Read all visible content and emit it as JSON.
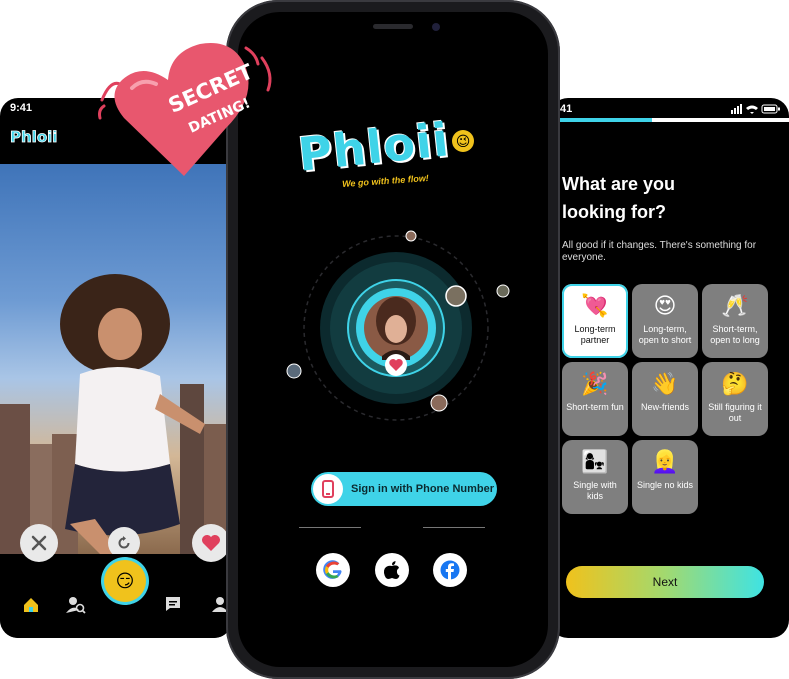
{
  "left_phone": {
    "status_time": "9:41",
    "logo": "Phloii",
    "actions": {
      "dislike_icon": "close-icon",
      "rewind_icon": "undo-icon",
      "like_icon": "heart-icon"
    },
    "nav": [
      "home-icon",
      "search-users-icon",
      "center-emoji-icon",
      "chat-icon",
      "profile-icon"
    ]
  },
  "badge": {
    "line1": "SECRET",
    "line2": "DATING!"
  },
  "center_phone": {
    "logo_text": "Phloii",
    "tagline": "We go with the flow!",
    "signin_label": "Sign in with Phone Number",
    "social": [
      "google-icon",
      "apple-icon",
      "facebook-icon"
    ]
  },
  "right_phone": {
    "status_time": "41",
    "title": "What are you looking for?",
    "subtitle": "All good if it changes. There's something for everyone.",
    "options": [
      {
        "emoji": "💘",
        "label": "Long-term partner",
        "selected": true
      },
      {
        "emoji": "😍",
        "label": "Long-term, open to short",
        "selected": false
      },
      {
        "emoji": "🥂",
        "label": "Short-term, open to long",
        "selected": false
      },
      {
        "emoji": "🎉",
        "label": "Short-term fun",
        "selected": false
      },
      {
        "emoji": "👋",
        "label": "New-friends",
        "selected": false
      },
      {
        "emoji": "🤔",
        "label": "Still figuring it out",
        "selected": false
      },
      {
        "emoji": "👩‍👧",
        "label": "Single with kids",
        "selected": false
      },
      {
        "emoji": "👱‍♀️",
        "label": "Single no kids",
        "selected": false
      }
    ],
    "next_label": "Next"
  },
  "colors": {
    "accent": "#3fd3e8",
    "heart": "#e0405d",
    "badge": "#e8576e",
    "yellow": "#f0c21c"
  }
}
